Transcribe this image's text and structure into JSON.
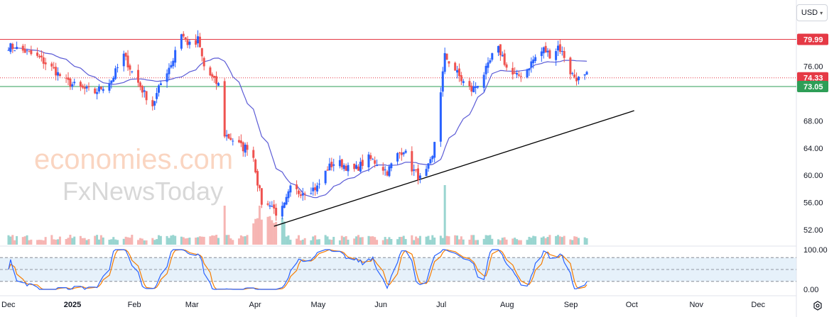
{
  "header": {
    "currency": "USD"
  },
  "watermark": {
    "brand": "economies.com",
    "subbrand": "FxNewsToday"
  },
  "badges": [
    {
      "label": "79.99",
      "value": 79.99,
      "color": "#e53945"
    },
    {
      "label": "74.33",
      "value": 74.33,
      "color": "#e53945"
    },
    {
      "label": "73.05",
      "value": 73.05,
      "color": "#2e9e57"
    }
  ],
  "indicator_ticks": [
    "100.00",
    "0.00"
  ],
  "colors": {
    "up": "#2962ff",
    "down": "#ef5350",
    "ma": "#5b5bd6",
    "resistance": "#e53945",
    "support": "#2e9e57",
    "trendline": "#000000",
    "volume_up": "#80cbc4",
    "volume_down": "#f4a3a0",
    "stoch_k": "#2962ff",
    "stoch_d": "#f57c00",
    "stoch_band": "#dcebf8"
  },
  "chart_data": {
    "type": "candlestick",
    "ylim": [
      50,
      84
    ],
    "yticks": [
      52,
      56,
      60,
      64,
      68,
      76
    ],
    "ytick_labels": [
      "52.00",
      "56.00",
      "60.00",
      "64.00",
      "68.00",
      "76.00"
    ],
    "x_month_labels": [
      {
        "label": "Dec",
        "day": 0,
        "bold": false
      },
      {
        "label": "2025",
        "day": 31,
        "bold": true
      },
      {
        "label": "Feb",
        "day": 62,
        "bold": false
      },
      {
        "label": "Mar",
        "day": 90,
        "bold": false
      },
      {
        "label": "Apr",
        "day": 121,
        "bold": false
      },
      {
        "label": "May",
        "day": 151,
        "bold": false
      },
      {
        "label": "Jun",
        "day": 182,
        "bold": false
      },
      {
        "label": "Jul",
        "day": 212,
        "bold": false
      },
      {
        "label": "Aug",
        "day": 243,
        "bold": false
      },
      {
        "label": "Sep",
        "day": 274,
        "bold": false
      },
      {
        "label": "Oct",
        "day": 304,
        "bold": false
      },
      {
        "label": "Nov",
        "day": 335,
        "bold": false
      },
      {
        "label": "Dec",
        "day": 365,
        "bold": false
      }
    ],
    "horizontal_levels": [
      {
        "value": 79.99,
        "color": "#e53945",
        "style": "solid"
      },
      {
        "value": 74.33,
        "color": "#e53945",
        "style": "dotted"
      },
      {
        "value": 73.05,
        "color": "#2e9e57",
        "style": "solid"
      }
    ],
    "trendline": {
      "from": [
        129,
        52.5
      ],
      "to": [
        304,
        69.5
      ]
    },
    "stoch_ylim": [
      0,
      100
    ],
    "stoch_band": [
      20,
      80
    ],
    "stoch_lines": [
      20,
      50,
      80
    ],
    "anchors": [
      [
        0,
        79.0
      ],
      [
        8,
        78.2
      ],
      [
        15,
        77.2
      ],
      [
        22,
        75.5
      ],
      [
        28,
        73.8
      ],
      [
        35,
        72.8
      ],
      [
        42,
        72.2
      ],
      [
        50,
        74.0
      ],
      [
        56,
        77.6
      ],
      [
        60,
        75.2
      ],
      [
        66,
        72.0
      ],
      [
        70,
        70.3
      ],
      [
        75,
        74.3
      ],
      [
        80,
        77.0
      ],
      [
        83,
        81.5
      ],
      [
        86,
        79.8
      ],
      [
        90,
        78.5
      ],
      [
        92,
        80.0
      ],
      [
        95,
        76.0
      ],
      [
        100,
        73.8
      ],
      [
        104,
        72.8
      ],
      [
        105,
        66.0
      ],
      [
        110,
        65.0
      ],
      [
        114,
        64.0
      ],
      [
        118,
        64.5
      ],
      [
        121,
        59.0
      ],
      [
        124,
        54.5
      ],
      [
        127,
        56.0
      ],
      [
        131,
        54.0
      ],
      [
        134,
        55.5
      ],
      [
        137,
        58.0
      ],
      [
        141,
        57.5
      ],
      [
        145,
        57.8
      ],
      [
        150,
        58.2
      ],
      [
        155,
        61.0
      ],
      [
        159,
        62.0
      ],
      [
        163,
        61.5
      ],
      [
        167,
        60.5
      ],
      [
        171,
        61.5
      ],
      [
        175,
        62.5
      ],
      [
        179,
        61.8
      ],
      [
        184,
        60.5
      ],
      [
        189,
        63.0
      ],
      [
        192,
        63.8
      ],
      [
        196,
        61.0
      ],
      [
        200,
        59.5
      ],
      [
        203,
        60.5
      ],
      [
        206,
        62.5
      ],
      [
        209,
        70.0
      ],
      [
        212,
        77.5
      ],
      [
        216,
        76.0
      ],
      [
        220,
        74.0
      ],
      [
        225,
        72.5
      ],
      [
        228,
        73.5
      ],
      [
        233,
        76.0
      ],
      [
        237,
        79.0
      ],
      [
        240,
        77.5
      ],
      [
        243,
        75.0
      ],
      [
        247,
        74.5
      ],
      [
        251,
        75.2
      ],
      [
        255,
        77.0
      ],
      [
        260,
        78.5
      ],
      [
        264,
        77.5
      ],
      [
        267,
        79.0
      ],
      [
        270,
        77.5
      ],
      [
        272,
        75.5
      ],
      [
        275,
        74.5
      ],
      [
        278,
        74.0
      ],
      [
        281,
        74.7
      ]
    ]
  }
}
